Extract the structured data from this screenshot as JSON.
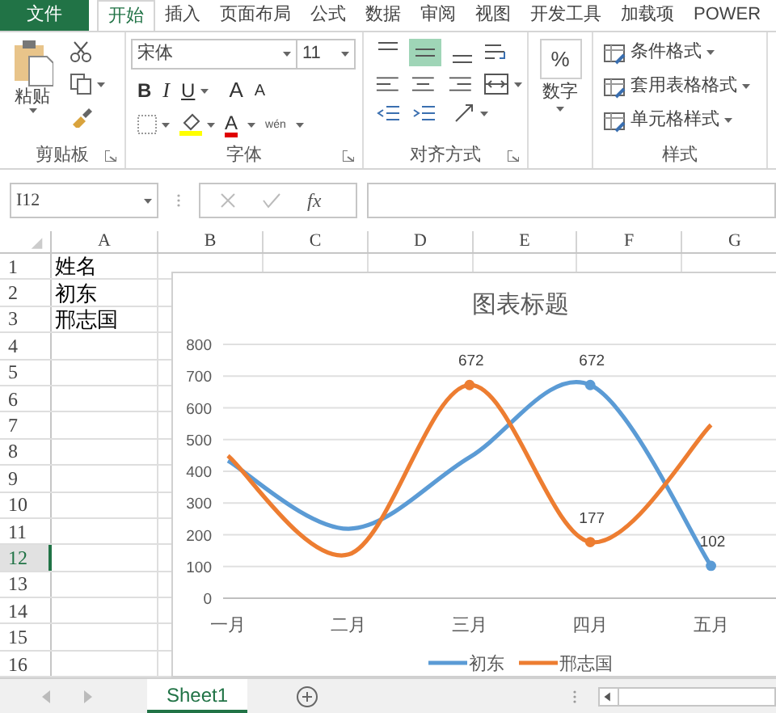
{
  "ribbon_tabs": [
    {
      "label": "文件",
      "kind": "file",
      "selected": false
    },
    {
      "label": "开始",
      "kind": "tab",
      "selected": true
    },
    {
      "label": "插入",
      "kind": "tab",
      "selected": false
    },
    {
      "label": "页面布局",
      "kind": "tab",
      "selected": false
    },
    {
      "label": "公式",
      "kind": "tab",
      "selected": false
    },
    {
      "label": "数据",
      "kind": "tab",
      "selected": false
    },
    {
      "label": "审阅",
      "kind": "tab",
      "selected": false
    },
    {
      "label": "视图",
      "kind": "tab",
      "selected": false
    },
    {
      "label": "开发工具",
      "kind": "tab",
      "selected": false
    },
    {
      "label": "加载项",
      "kind": "tab",
      "selected": false
    },
    {
      "label": "POWER",
      "kind": "tab",
      "selected": false
    }
  ],
  "ribbon": {
    "clipboard": {
      "label": "剪贴板",
      "paste": "粘贴"
    },
    "font": {
      "label": "字体",
      "font_name": "宋体",
      "font_size": "11",
      "bold": "B",
      "italic": "I",
      "underline": "U",
      "grow": "A",
      "shrink": "A",
      "font_color": "A",
      "phonetic": "wén"
    },
    "alignment": {
      "label": "对齐方式",
      "vertical": [
        {
          "kind": "top",
          "selected": false
        },
        {
          "kind": "middle",
          "selected": true
        },
        {
          "kind": "bottom",
          "selected": false
        }
      ]
    },
    "number": {
      "label": "数字",
      "symbol": "%"
    },
    "styles": {
      "label": "样式",
      "items": [
        "条件格式",
        "套用表格格式",
        "单元格样式"
      ]
    }
  },
  "formula_bar": {
    "name_box": "I12",
    "function_label": "fx"
  },
  "columns": [
    "A",
    "B",
    "C",
    "D",
    "E",
    "F",
    "G"
  ],
  "rows": [
    {
      "number": "1",
      "cell": "姓名",
      "selected": false
    },
    {
      "number": "2",
      "cell": "初东",
      "selected": false
    },
    {
      "number": "3",
      "cell": "邢志国",
      "selected": false
    },
    {
      "number": "4",
      "selected": false
    },
    {
      "number": "5",
      "selected": false
    },
    {
      "number": "6",
      "selected": false
    },
    {
      "number": "7",
      "selected": false
    },
    {
      "number": "8",
      "selected": false
    },
    {
      "number": "9",
      "selected": false
    },
    {
      "number": "10",
      "selected": false
    },
    {
      "number": "11",
      "selected": false
    },
    {
      "number": "12",
      "selected": true
    },
    {
      "number": "13",
      "selected": false
    },
    {
      "number": "14",
      "selected": false
    },
    {
      "number": "15",
      "selected": false
    },
    {
      "number": "16",
      "selected": false
    }
  ],
  "chart": {
    "chart_data": {
      "type": "line",
      "title": "图表标题",
      "categories": [
        "一月",
        "二月",
        "三月",
        "四月",
        "五月"
      ],
      "series": [
        {
          "name": "初东",
          "color": "#5b9bd5",
          "values": [
            433,
            219,
            444,
            672,
            102
          ]
        },
        {
          "name": "邢志国",
          "color": "#ed7d31",
          "values": [
            449,
            138,
            672,
            177,
            546
          ]
        }
      ],
      "ylim": [
        0,
        800
      ],
      "yticks": [
        0,
        100,
        200,
        300,
        400,
        500,
        600,
        700,
        800
      ],
      "grid": true,
      "legend": "bottom",
      "annotations": [
        {
          "x": "三月",
          "y": 672,
          "text": "672"
        },
        {
          "x": "四月",
          "y": 672,
          "text": "672"
        },
        {
          "x": "四月",
          "y": 177,
          "text": "177"
        },
        {
          "x": "五月",
          "y": 102,
          "text": "102"
        }
      ]
    }
  },
  "sheet_tabs": [
    {
      "label": "Sheet1",
      "selected": true
    }
  ]
}
